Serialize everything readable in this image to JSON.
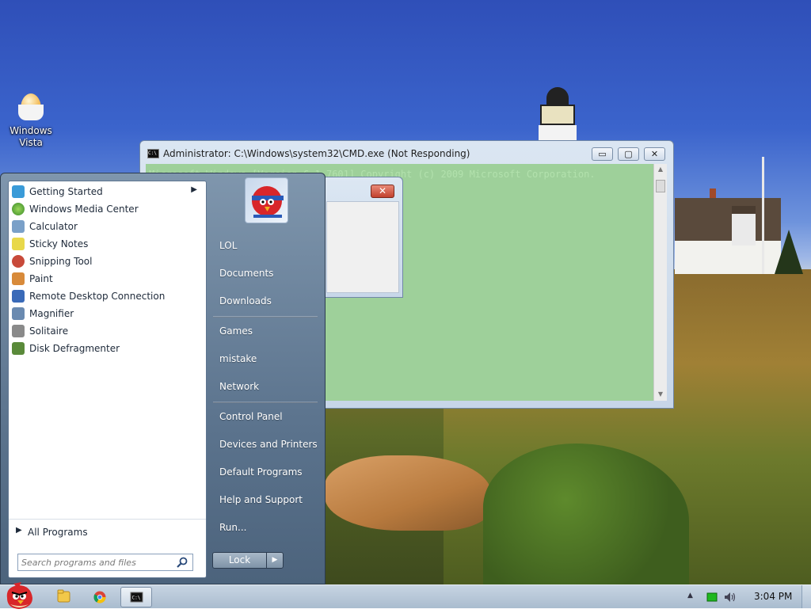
{
  "desktop": {
    "icons": [
      {
        "label_line1": "Windows",
        "label_line2": "Vista",
        "icon": "egg-icon"
      }
    ]
  },
  "cmd_window": {
    "title": "Administrator: C:\\Windows\\system32\\CMD.exe (Not Responding)",
    "faded_text": "Microsoft Windows [Version 6.1.7601]   Copyright (c) 2009 Microsoft Corporation.",
    "buttons": {
      "minimize": "▭",
      "maximize": "▢",
      "close": "✕"
    },
    "background_color": "#9ed09a"
  },
  "dialog": {
    "close": "✕"
  },
  "start_menu": {
    "programs": [
      {
        "label": "Getting Started",
        "icon": "getting-started-icon",
        "has_submenu": true,
        "color": "#3a9bd8"
      },
      {
        "label": "Windows Media Center",
        "icon": "media-center-icon",
        "color": "#4aa33a"
      },
      {
        "label": "Calculator",
        "icon": "calculator-icon",
        "color": "#7aa0c8"
      },
      {
        "label": "Sticky Notes",
        "icon": "sticky-notes-icon",
        "color": "#e8d84a"
      },
      {
        "label": "Snipping Tool",
        "icon": "snipping-tool-icon",
        "color": "#c84a3a"
      },
      {
        "label": "Paint",
        "icon": "paint-icon",
        "color": "#d88a3a"
      },
      {
        "label": "Remote Desktop Connection",
        "icon": "remote-desktop-icon",
        "color": "#3a6ab8"
      },
      {
        "label": "Magnifier",
        "icon": "magnifier-icon",
        "color": "#6a8ab0"
      },
      {
        "label": "Solitaire",
        "icon": "solitaire-icon",
        "color": "#8a8a8a"
      },
      {
        "label": "Disk Defragmenter",
        "icon": "disk-defragmenter-icon",
        "color": "#5a8a3a"
      }
    ],
    "all_programs": "All Programs",
    "search": {
      "placeholder": "Search programs and files",
      "value": ""
    },
    "right_items": [
      {
        "label": "LOL"
      },
      {
        "label": "Documents"
      },
      {
        "label": "Downloads"
      },
      {
        "label": "Games"
      },
      {
        "label": "mistake"
      },
      {
        "label": "Network"
      },
      {
        "label": "Control Panel"
      },
      {
        "label": "Devices and Printers"
      },
      {
        "label": "Default Programs"
      },
      {
        "label": "Help and Support"
      },
      {
        "label": "Run..."
      }
    ],
    "lock_label": "Lock",
    "lock_arrow": "▶"
  },
  "taskbar": {
    "pinned": [
      {
        "name": "windows-explorer",
        "icon": "folder-icon"
      },
      {
        "name": "chrome",
        "icon": "chrome-icon"
      },
      {
        "name": "cmd",
        "icon": "cmd-icon",
        "active": true
      }
    ],
    "clock": "3:04 PM",
    "tray_arrow": "▲"
  }
}
